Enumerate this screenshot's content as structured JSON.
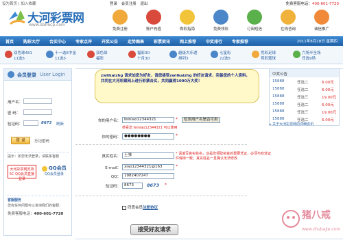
{
  "topbar": {
    "left_links": "设为首页 | 加入收藏",
    "hotline_label": "免费客服电话：",
    "hotline": "400-601-7720"
  },
  "header": {
    "brand": "大河彩票网",
    "url": "www.dahecp.com",
    "user_links": [
      "登录",
      "会员注册",
      "退出"
    ]
  },
  "icon_menu": [
    {
      "label": "免费注册",
      "color": "#f0a93a"
    },
    {
      "label": "账户充值",
      "color": "#d94a3c"
    },
    {
      "label": "购彩指南",
      "color": "#f2c43a"
    },
    {
      "label": "免费领彩",
      "color": "#4a86c8"
    },
    {
      "label": "订阅短信",
      "color": "#5ab04a"
    },
    {
      "label": "在线咨询",
      "color": "#f0b23a"
    },
    {
      "label": "诚信推广",
      "color": "#f08a3a"
    }
  ],
  "nav": {
    "items": [
      "首页",
      "购彩大厅",
      "合买中心",
      "专家点评",
      "开奖公告",
      "走势图表",
      "彩票资讯",
      "网上推荐",
      "中奖排行",
      "专家推荐"
    ],
    "date": "2011年8月18日 星期四"
  },
  "lottery_strip": [
    {
      "line1": "双色球481",
      "line2": "11选5",
      "color": "#d94a3c"
    },
    {
      "line1": "十一选5中金",
      "line2": "11选5",
      "color": "#4a86c8"
    },
    {
      "line1": "双色球",
      "line2": "福彩",
      "color": "#d94a3c"
    },
    {
      "line1": "福彩3D",
      "line2": "十月3D",
      "color": "#d94a3c"
    },
    {
      "line1": "超级大乐透",
      "line2": "排列3",
      "color": "#4a86c8"
    },
    {
      "line1": "七星彩",
      "line2": "22选5",
      "color": "#4a86c8"
    },
    {
      "line1": "竞彩足球",
      "line2": "竞彩篮球",
      "color": "#f0a93a"
    },
    {
      "line1": "六场半全场",
      "line2": "任选9场",
      "color": "#5ab04a"
    }
  ],
  "login": {
    "title": "会员登录",
    "title_en": "User Login",
    "username_label": "用户名：",
    "password_label": "密  码：",
    "captcha_label": "验证码：",
    "captcha_value": "8673",
    "refresh": "刷新",
    "login_button": "登 录",
    "forgot": "忘记密码",
    "notice": "提示：如您无法登录，请联系客服",
    "partner1": "大河彩票网支持5C QQ会员直接登录",
    "partner2": "QQ会员",
    "partner2_sub": "QQ会员登录",
    "service_title": "客服服务",
    "service_text": "您有任何问题可以咨询我们的客服：",
    "service_phone_label": "免费客服电话：",
    "service_phone": "400-601-7720"
  },
  "form": {
    "bubble_text": "zwlikaizhg 请求加您为好友，请您接受zwlikaizhg 的好友请求，完善您的个人资料，共同在大河彩票网上进行彩票合买，共同赢得1000万大奖！",
    "username_label": "你的用户名：",
    "username_value": "feiniao12344321",
    "check_button": "检测用户名是否可用",
    "username_ok": "恭喜您 feiniao12344321 可以使用",
    "password_label": "你的密码：",
    "password_value": "●●●●●●●●",
    "realname_label": "真实姓名：",
    "realname_value": "王强",
    "realname_tip": "* 请填写真实姓名，这是您领取奖金的重要凭证，必须与有效证件保持一致，真实姓名一旦确认无法修改",
    "email_label": "E-mail：",
    "email_value": "xiao12344321@163",
    "qq_label": "QQ：",
    "qq_value": "1982407247",
    "captcha_label": "验证码：",
    "captcha_value": "8673",
    "captcha_img": "8673",
    "agree_prefix": "同意会员",
    "agree_link": "注册协议",
    "submit": "接受好友请求"
  },
  "winners": {
    "title": "中奖公告",
    "rows": [
      {
        "num": "15888",
        "type": "任选二",
        "amount": "6.00元"
      },
      {
        "num": "15888",
        "type": "任选二",
        "amount": "6.00元"
      },
      {
        "num": "15888",
        "type": "任选三",
        "amount": "19.00元"
      },
      {
        "num": "15888",
        "type": "任选二",
        "amount": "6.00元"
      },
      {
        "num": "15888",
        "type": "任选三",
        "amount": "19.00元"
      },
      {
        "num": "15888",
        "type": "任选二",
        "amount": "6.00元"
      }
    ],
    "link": "▸ 关于大河彩票网的详细资讯"
  },
  "watermark": {
    "cn": "猪八戒",
    "url": "www.zhubajie.com"
  }
}
